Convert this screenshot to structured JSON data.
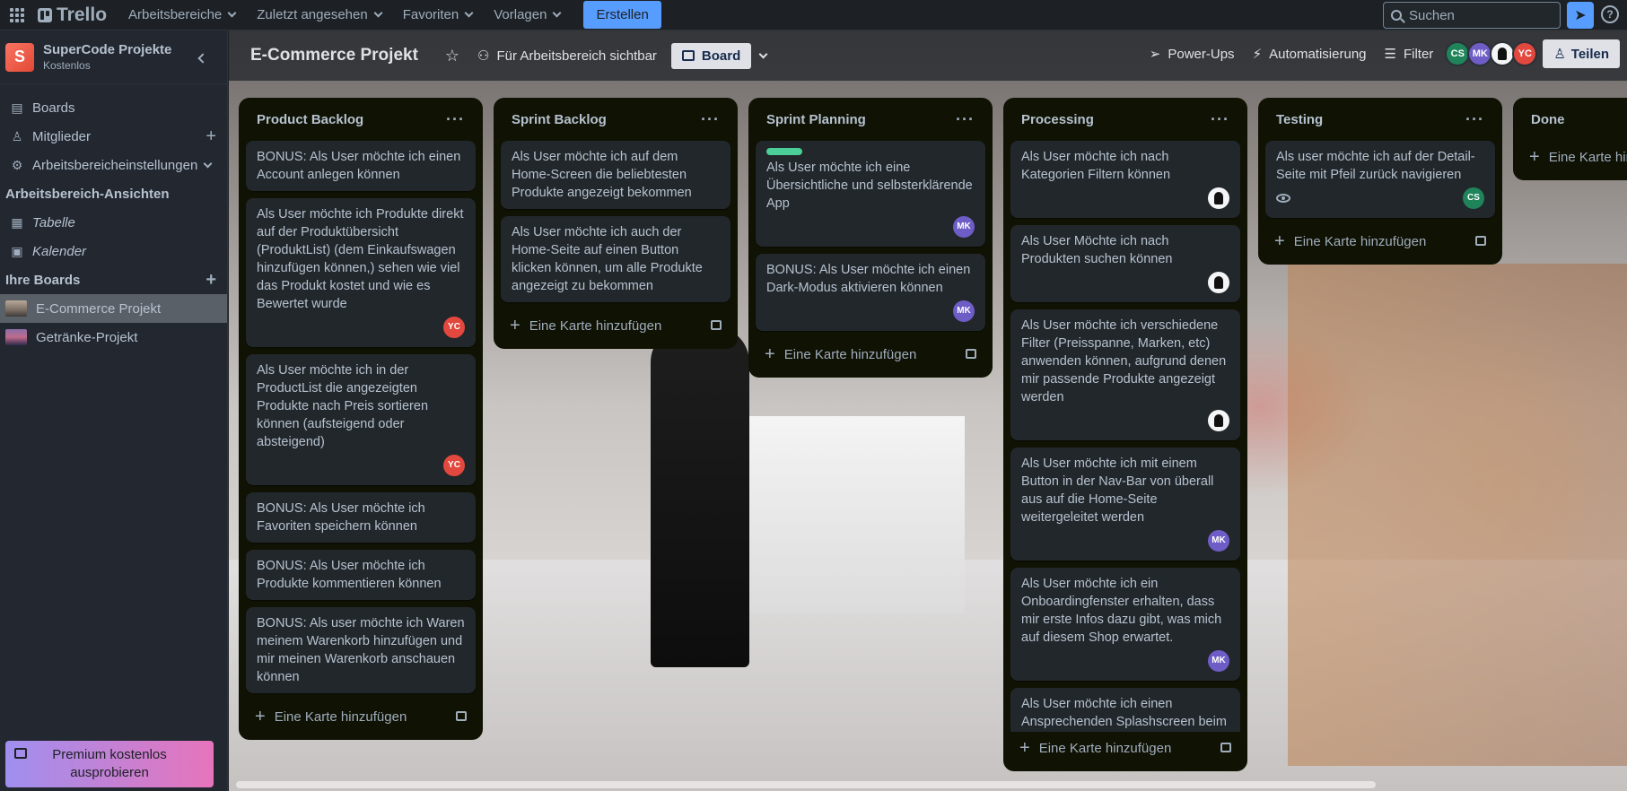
{
  "topnav": {
    "logo": "Trello",
    "items": [
      {
        "label": "Arbeitsbereiche"
      },
      {
        "label": "Zuletzt angesehen"
      },
      {
        "label": "Favoriten"
      },
      {
        "label": "Vorlagen"
      }
    ],
    "create_label": "Erstellen",
    "search_placeholder": "Suchen"
  },
  "sidebar": {
    "workspace_initial": "S",
    "workspace_name": "SuperCode Projekte",
    "workspace_plan": "Kostenlos",
    "nav": [
      {
        "label": "Boards",
        "icon": "board-icon"
      },
      {
        "label": "Mitglieder",
        "icon": "person-icon"
      },
      {
        "label": "Arbeitsbereicheinstellungen",
        "icon": "gear-icon"
      }
    ],
    "views_heading": "Arbeitsbereich-Ansichten",
    "views": [
      {
        "label": "Tabelle",
        "icon": "table-icon"
      },
      {
        "label": "Kalender",
        "icon": "calendar-icon"
      }
    ],
    "boards_heading": "Ihre Boards",
    "boards": [
      {
        "label": "E-Commerce Projekt",
        "active": true
      },
      {
        "label": "Getränke-Projekt",
        "active": false
      }
    ],
    "premium_label": "Premium kostenlos ausprobieren"
  },
  "board": {
    "title": "E-Commerce Projekt",
    "visibility": "Für Arbeitsbereich sichtbar",
    "view_label": "Board",
    "powerups": "Power-Ups",
    "automation": "Automatisierung",
    "filter": "Filter",
    "members": [
      "CS",
      "MK",
      "",
      "YC"
    ],
    "share_label": "Teilen",
    "add_card_label": "Eine Karte hinzufügen"
  },
  "lists": [
    {
      "title": "Product Backlog",
      "cards": [
        {
          "text": "BONUS: Als User möchte ich einen Account anlegen können"
        },
        {
          "text": "Als User möchte ich Produkte direkt auf der Produktübersicht (ProduktList) (dem Einkaufswagen hinzufügen können,) sehen wie viel das Produkt kostet und wie es Bewertet wurde",
          "member": "YC"
        },
        {
          "text": "Als User möchte ich in der ProductList die angezeigten Produkte nach Preis sortieren können (aufsteigend oder absteigend)",
          "member": "YC"
        },
        {
          "text": "BONUS: Als User möchte ich Favoriten speichern können"
        },
        {
          "text": "BONUS: Als User möchte ich Produkte kommentieren können"
        },
        {
          "text": "BONUS: Als user möchte ich Waren meinem Warenkorb hinzufügen und mir meinen Warenkorb anschauen können"
        }
      ]
    },
    {
      "title": "Sprint Backlog",
      "cards": [
        {
          "text": "Als User möchte ich auf dem Home-Screen die beliebtesten Produkte angezeigt bekommen"
        },
        {
          "text": "Als User möchte ich auch der Home-Seite auf einen Button klicken können, um alle Produkte angezeigt zu bekommen"
        }
      ]
    },
    {
      "title": "Sprint Planning",
      "cards": [
        {
          "text": "Als User möchte ich eine Übersichtliche und selbsterklärende App",
          "member": "MK",
          "label_color": "#4bce97"
        },
        {
          "text": "BONUS: Als User möchte ich einen Dark-Modus aktivieren können",
          "member": "MK"
        }
      ]
    },
    {
      "title": "Processing",
      "cards": [
        {
          "text": "Als User möchte ich nach Kategorien Filtern können",
          "member": "photo"
        },
        {
          "text": "Als User Möchte ich nach Produkten suchen können",
          "member": "photo"
        },
        {
          "text": "Als User möchte ich verschiedene Filter (Preisspanne, Marken, etc) anwenden können, aufgrund denen mir passende Produkte angezeigt werden",
          "member": "photo"
        },
        {
          "text": "Als User möchte ich mit einem Button in der Nav-Bar von überall aus auf die Home-Seite weitergeleitet werden",
          "member": "MK"
        },
        {
          "text": "Als User möchte ich ein Onboardingfenster erhalten, dass mir erste Infos dazu gibt, was mich auf diesem Shop erwartet.",
          "member": "MK"
        },
        {
          "text": "Als User möchte ich einen Ansprechenden Splashscreen beim öffnen der App angezeigt"
        }
      ]
    },
    {
      "title": "Testing",
      "cards": [
        {
          "text": "Als user möchte ich auf der Detail-Seite mit Pfeil zurück navigieren",
          "member": "CS",
          "watching": true
        }
      ]
    },
    {
      "title": "Done",
      "cards": []
    }
  ],
  "colors": {
    "accent": "#579dff",
    "background": "#1d2125",
    "list": "#101204",
    "card": "#22272b"
  }
}
